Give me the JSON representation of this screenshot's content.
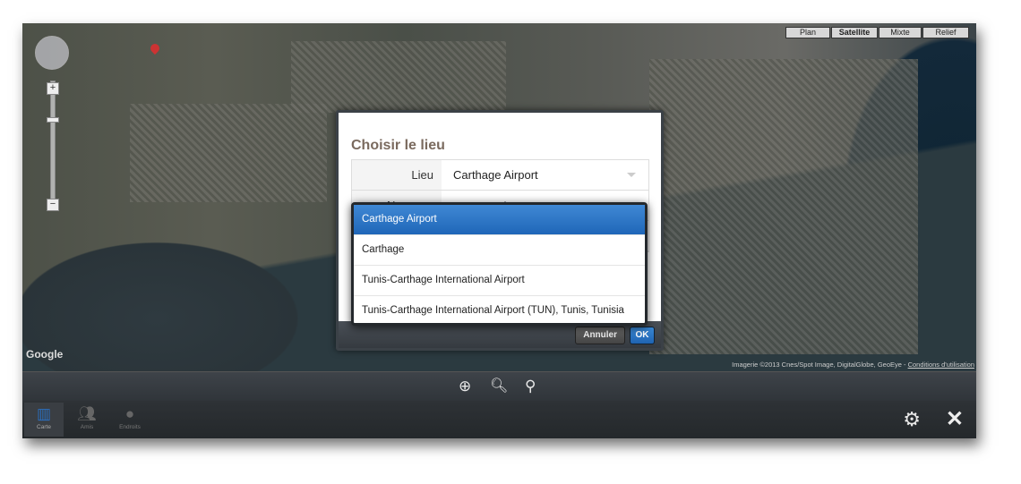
{
  "map": {
    "map_types": [
      {
        "label": "Plan",
        "active": false
      },
      {
        "label": "Satellite",
        "active": true
      },
      {
        "label": "Mixte",
        "active": false
      },
      {
        "label": "Relief",
        "active": false
      }
    ],
    "zoom_in": "+",
    "zoom_out": "−",
    "logo": "Google",
    "attribution": "Imagerie ©2013 Cnes/Spot Image, DigitalGlobe, GeoEye - ",
    "terms_link": "Conditions d'utilisation"
  },
  "toolbar": {
    "icons": [
      "crosshair-icon",
      "search-icon",
      "map-pin-icon"
    ]
  },
  "tabs": [
    {
      "label": "Carte",
      "icon": "map-icon",
      "active": true
    },
    {
      "label": "Amis",
      "icon": "people-icon",
      "active": false
    },
    {
      "label": "Endroits",
      "icon": "pin-icon",
      "active": false
    }
  ],
  "dialog": {
    "title": "Choisir le lieu",
    "fields": [
      {
        "label": "Lieu",
        "value": "Carthage Airport"
      },
      {
        "label": "Nouveau",
        "value": ""
      }
    ],
    "cancel_label": "Annuler",
    "ok_label": "OK"
  },
  "dropdown": {
    "selected": "Carthage Airport",
    "options": [
      "Carthage Airport",
      "Carthage",
      "Tunis-Carthage International Airport",
      "Tunis-Carthage International Airport (TUN), Tunis, Tunisia"
    ]
  },
  "colors": {
    "accent": "#2a6fc0",
    "dialog_title": "#7a6a5e"
  }
}
